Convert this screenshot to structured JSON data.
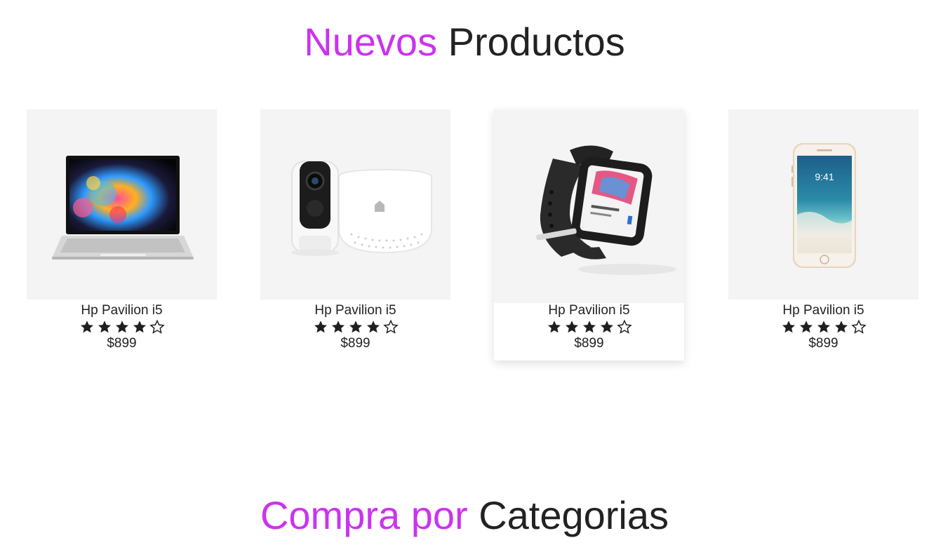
{
  "sections": {
    "new_products": {
      "accent": "Nuevos",
      "rest": "Productos"
    },
    "categories": {
      "accent": "Compra por",
      "rest": "Categorias"
    }
  },
  "colors": {
    "accent": "#cc33ee",
    "text": "#222222",
    "card_bg": "#f4f4f4"
  },
  "products": [
    {
      "image": "laptop-image",
      "name": "Hp Pavilion i5",
      "rating": 4,
      "max_rating": 5,
      "price": "$899"
    },
    {
      "image": "security-camera-image",
      "name": "Hp Pavilion i5",
      "rating": 4,
      "max_rating": 5,
      "price": "$899"
    },
    {
      "image": "smartwatch-image",
      "name": "Hp Pavilion i5",
      "rating": 4,
      "max_rating": 5,
      "price": "$899"
    },
    {
      "image": "smartphone-image",
      "name": "Hp Pavilion i5",
      "rating": 4,
      "max_rating": 5,
      "price": "$899"
    }
  ]
}
